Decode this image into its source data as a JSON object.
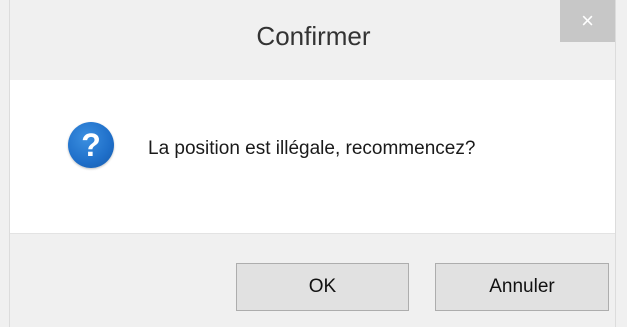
{
  "dialog": {
    "title": "Confirmer",
    "close_glyph": "×",
    "icon": "question-icon",
    "icon_glyph": "?",
    "message": "La position est illégale, recommencez?",
    "buttons": {
      "ok_label": "OK",
      "cancel_label": "Annuler"
    },
    "colors": {
      "icon_blue": "#1f6fc9",
      "close_bg": "#c7c7c7",
      "chrome_bg": "#f0f0f0"
    }
  }
}
